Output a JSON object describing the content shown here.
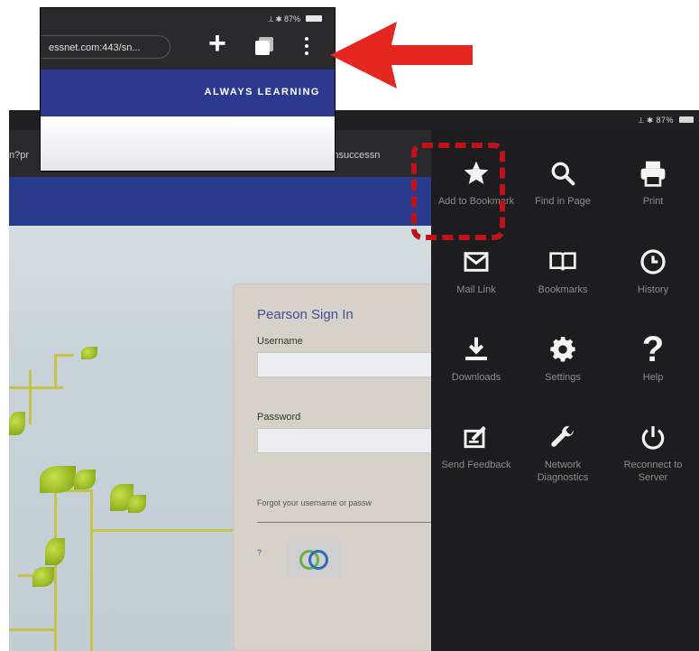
{
  "inset": {
    "status": "⟂ ✱ 87%",
    "url": "essnet.com:443/sn...",
    "brand_banner": "ALWAYS LEARNING"
  },
  "main": {
    "status": "⟂ ✱ 87%",
    "url_left_fragment": "n?pr",
    "url_right_fragment": "ersonsuccessn",
    "signin": {
      "title": "Pearson Sign In",
      "username_label": "Username",
      "password_label": "Password",
      "forgot_text": "Forgot your username or passw",
      "help_mark": "?"
    }
  },
  "menu": {
    "items": [
      {
        "label": "Add to Bookmark",
        "icon": "star-icon"
      },
      {
        "label": "Find in Page",
        "icon": "search-icon"
      },
      {
        "label": "Print",
        "icon": "printer-icon"
      },
      {
        "label": "Mail Link",
        "icon": "mail-icon"
      },
      {
        "label": "Bookmarks",
        "icon": "book-icon"
      },
      {
        "label": "History",
        "icon": "clock-icon"
      },
      {
        "label": "Downloads",
        "icon": "download-icon"
      },
      {
        "label": "Settings",
        "icon": "gear-icon"
      },
      {
        "label": "Help",
        "icon": "question-icon"
      },
      {
        "label": "Send Feedback",
        "icon": "feedback-icon"
      },
      {
        "label": "Network Diagnostics",
        "icon": "wrench-icon"
      },
      {
        "label": "Reconnect to Server",
        "icon": "power-icon"
      }
    ]
  },
  "colors": {
    "menu_bg": "#1d1d1f",
    "highlight": "#c0121b",
    "arrow": "#e5271f",
    "pearson_blue": "#2a3a8d"
  }
}
